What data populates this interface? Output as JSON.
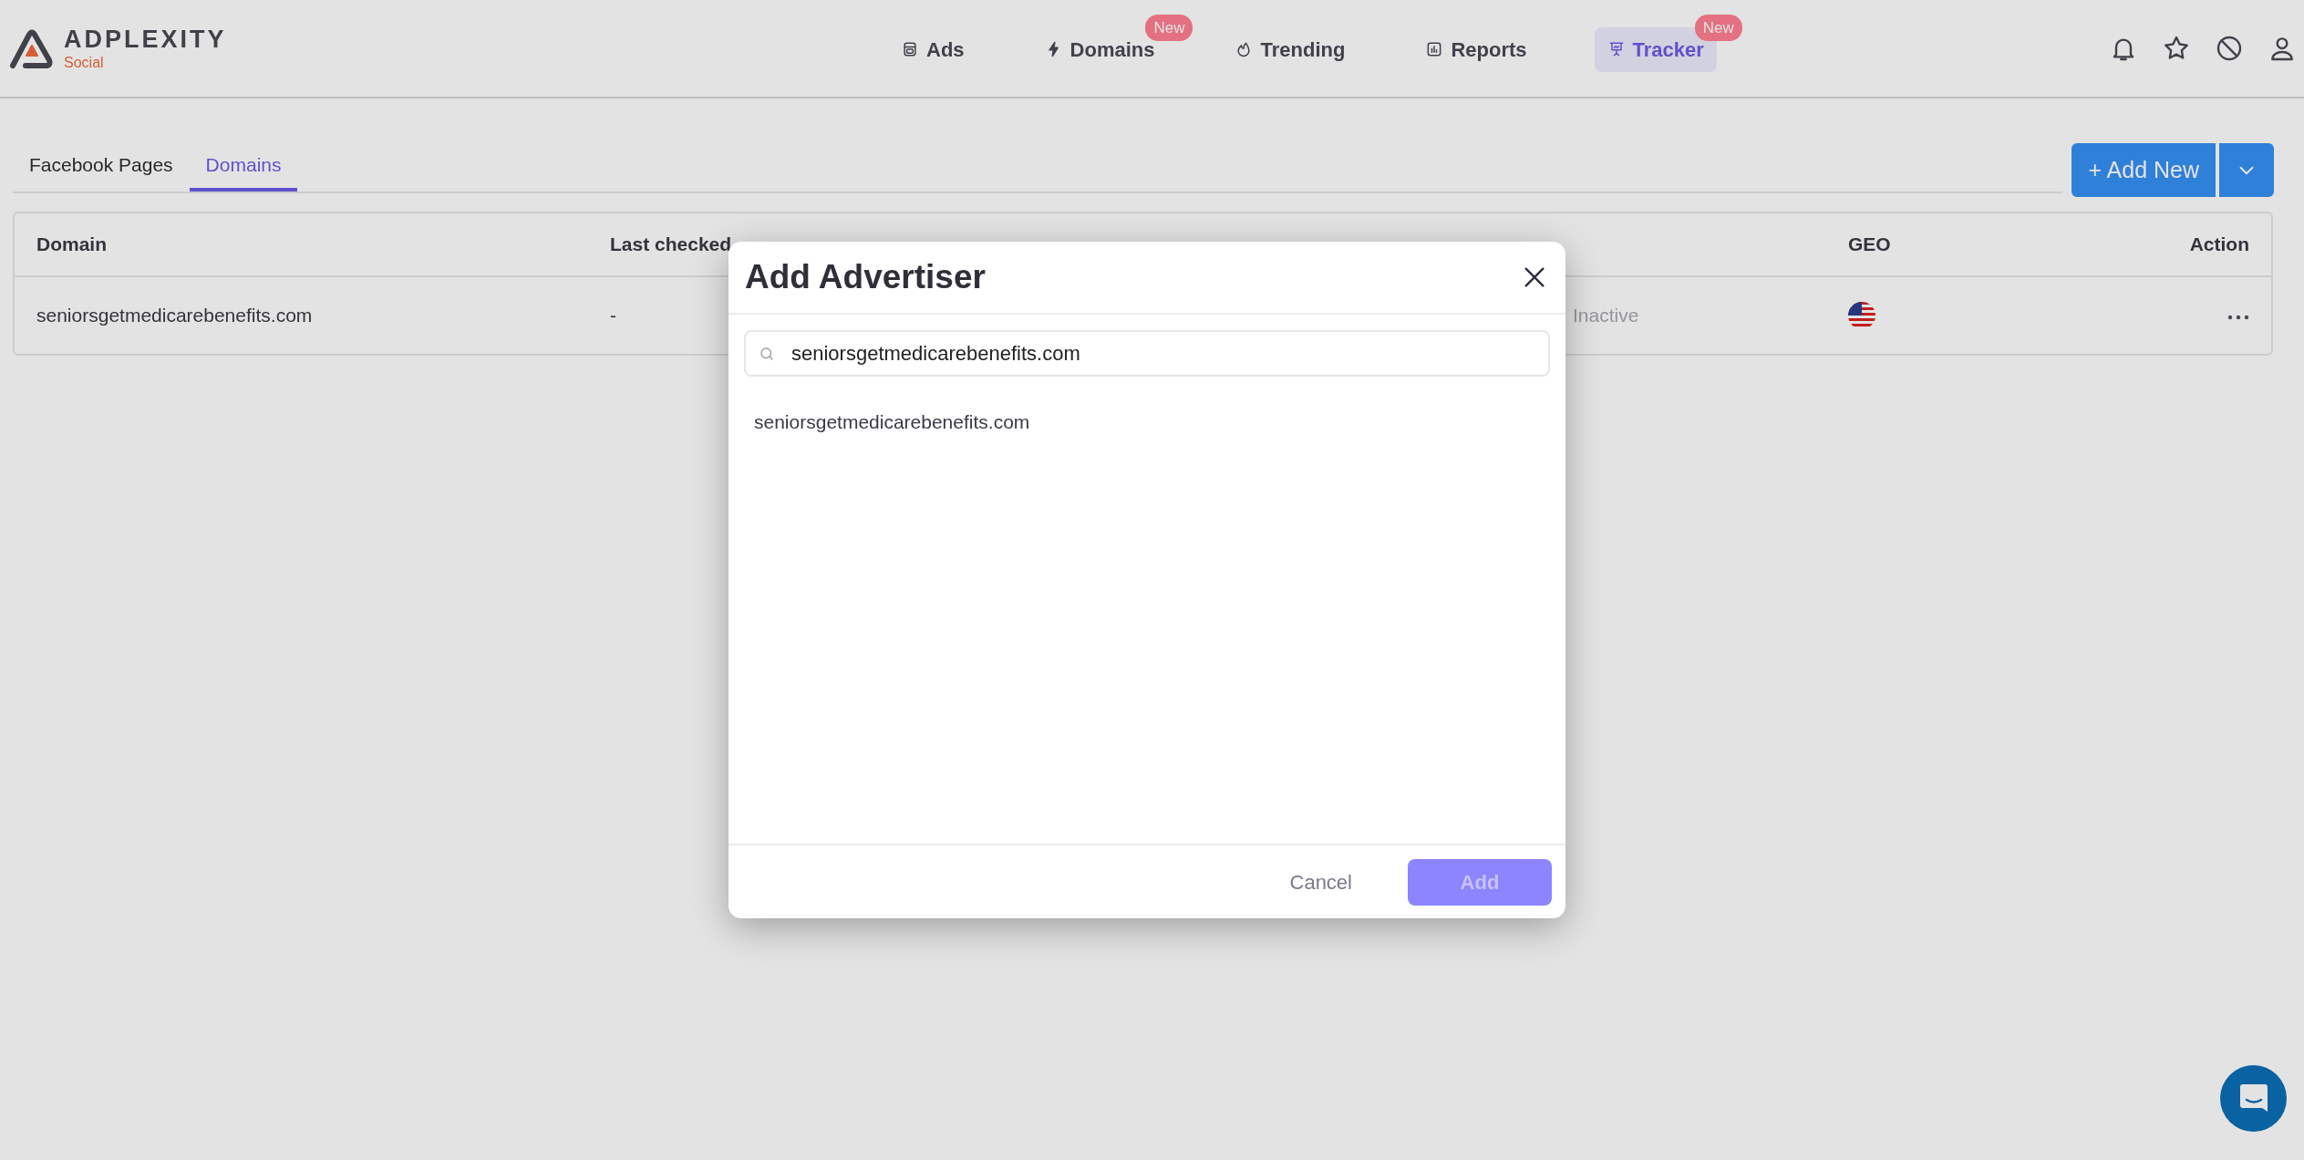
{
  "header": {
    "logo": {
      "name": "ADPLEXITY",
      "tagline": "Social"
    },
    "nav": [
      {
        "label": "Ads",
        "selected": false
      },
      {
        "label": "Domains",
        "selected": false,
        "badge": "New"
      },
      {
        "label": "Trending",
        "selected": false
      },
      {
        "label": "Reports",
        "selected": false
      },
      {
        "label": "Tracker",
        "selected": true,
        "badge": "New"
      }
    ]
  },
  "tabs": [
    {
      "label": "Facebook Pages",
      "selected": false
    },
    {
      "label": "Domains",
      "selected": true
    }
  ],
  "add_button": {
    "label": "+ Add New"
  },
  "table": {
    "columns": [
      {
        "label": "Domain"
      },
      {
        "label": "Last checked"
      },
      {
        "label": "GEO"
      },
      {
        "label": "Action"
      }
    ],
    "rows": [
      {
        "domain": "seniorsgetmedicarebenefits.com",
        "last_checked": "-",
        "status": "Inactive"
      }
    ]
  },
  "modal": {
    "title": "Add Advertiser",
    "search": {
      "value": "seniorsgetmedicarebenefits.com"
    },
    "results": [
      "seniorsgetmedicarebenefits.com"
    ],
    "cancel": "Cancel",
    "add": {
      "label": "Add",
      "disabled": true
    }
  }
}
